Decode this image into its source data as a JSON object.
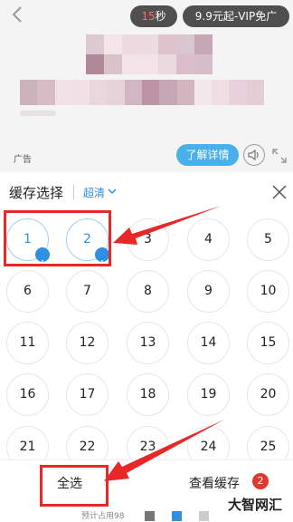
{
  "ad": {
    "timer_value": "15",
    "timer_unit": "秒",
    "vip_label": "9.9元起-VIP免广",
    "ad_label": "广告",
    "detail_button": "了解详情",
    "mosaic_colors": [
      "#c9a7b3",
      "#e8cfd8",
      "#b68a9b",
      "#f2dfe6",
      "#d9b8c5",
      "#a87d90",
      "#eed6df",
      "#c5a0b0"
    ]
  },
  "panel": {
    "title": "缓存选择",
    "quality": "超清"
  },
  "episodes": {
    "items": [
      "1",
      "2",
      "3",
      "4",
      "5",
      "6",
      "7",
      "8",
      "9",
      "10",
      "11",
      "12",
      "13",
      "14",
      "15",
      "16",
      "17",
      "18",
      "19",
      "20",
      "21",
      "22",
      "23",
      "24",
      "25"
    ],
    "selected": [
      "1",
      "2"
    ]
  },
  "bottom": {
    "select_all": "全选",
    "view_cache": "查看缓存",
    "cache_count": "2",
    "storage_text": "预计占用98",
    "watermark": "大智网汇"
  },
  "colors": {
    "accent": "#2f8fe0",
    "detail_button": "#4ab0ea",
    "badge_red": "#e0382f",
    "annotation_red": "#e62828"
  }
}
